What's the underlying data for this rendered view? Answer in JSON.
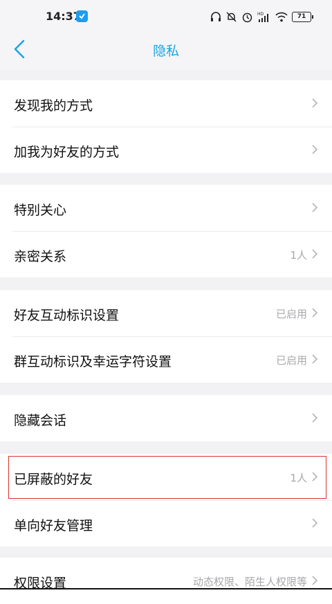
{
  "status_bar": {
    "time": "14:37",
    "battery": "71",
    "icons": [
      "app-notification-icon",
      "headset-icon",
      "alarm-off-icon",
      "alarm-icon",
      "hd-signal-icon",
      "wifi-icon",
      "battery-icon"
    ]
  },
  "nav": {
    "title": "隐私",
    "back_icon": "chevron-left-icon"
  },
  "groups": [
    {
      "items": [
        {
          "label": "发现我的方式",
          "value": ""
        },
        {
          "label": "加我为好友的方式",
          "value": ""
        }
      ]
    },
    {
      "items": [
        {
          "label": "特别关心",
          "value": ""
        },
        {
          "label": "亲密关系",
          "value": "1人"
        }
      ]
    },
    {
      "items": [
        {
          "label": "好友互动标识设置",
          "value": "已启用"
        },
        {
          "label": "群互动标识及幸运字符设置",
          "value": "已启用"
        }
      ]
    },
    {
      "items": [
        {
          "label": "隐藏会话",
          "value": ""
        }
      ]
    },
    {
      "items": [
        {
          "label": "已屏蔽的好友",
          "value": "1人"
        },
        {
          "label": "单向好友管理",
          "value": ""
        }
      ]
    },
    {
      "items": [
        {
          "label": "权限设置",
          "value": "动态权限、陌生人权限等"
        }
      ]
    }
  ],
  "colors": {
    "accent": "#1aa3e8",
    "highlight_border": "#d9302b"
  }
}
